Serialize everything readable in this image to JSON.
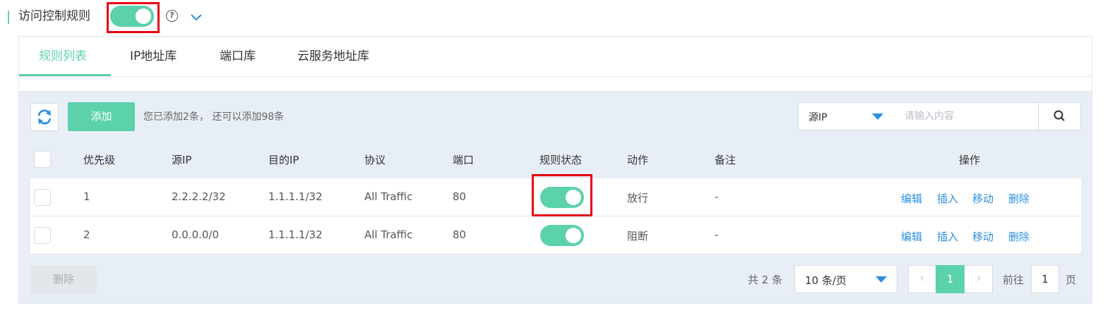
{
  "header": {
    "title": "访问控制规则",
    "enabled": true
  },
  "tabs": [
    {
      "label": "规则列表",
      "active": true
    },
    {
      "label": "IP地址库",
      "active": false
    },
    {
      "label": "端口库",
      "active": false
    },
    {
      "label": "云服务地址库",
      "active": false
    }
  ],
  "toolbar": {
    "add_label": "添加",
    "info_text": "您已添加2条， 还可以添加98条",
    "search_field": "源IP",
    "search_placeholder": "请输入内容"
  },
  "table": {
    "columns": [
      "优先级",
      "源IP",
      "目的IP",
      "协议",
      "端口",
      "规则状态",
      "动作",
      "备注",
      "操作"
    ],
    "rows": [
      {
        "priority": "1",
        "src_ip": "2.2.2.2/32",
        "dst_ip": "1.1.1.1/32",
        "protocol": "All Traffic",
        "port": "80",
        "status_on": true,
        "action": "放行",
        "remark": "-"
      },
      {
        "priority": "2",
        "src_ip": "0.0.0.0/0",
        "dst_ip": "1.1.1.1/32",
        "protocol": "All Traffic",
        "port": "80",
        "status_on": true,
        "action": "阻断",
        "remark": "-"
      }
    ],
    "ops": [
      "编辑",
      "插入",
      "移动",
      "删除"
    ]
  },
  "footer": {
    "delete_label": "删除",
    "total_text": "共 2 条",
    "page_size": "10 条/页",
    "current_page": "1",
    "goto_label": "前往",
    "goto_value": "1",
    "page_unit": "页"
  },
  "colors": {
    "accent": "#5bd1ac",
    "link": "#2b8fe0",
    "highlight": "#e60012"
  }
}
